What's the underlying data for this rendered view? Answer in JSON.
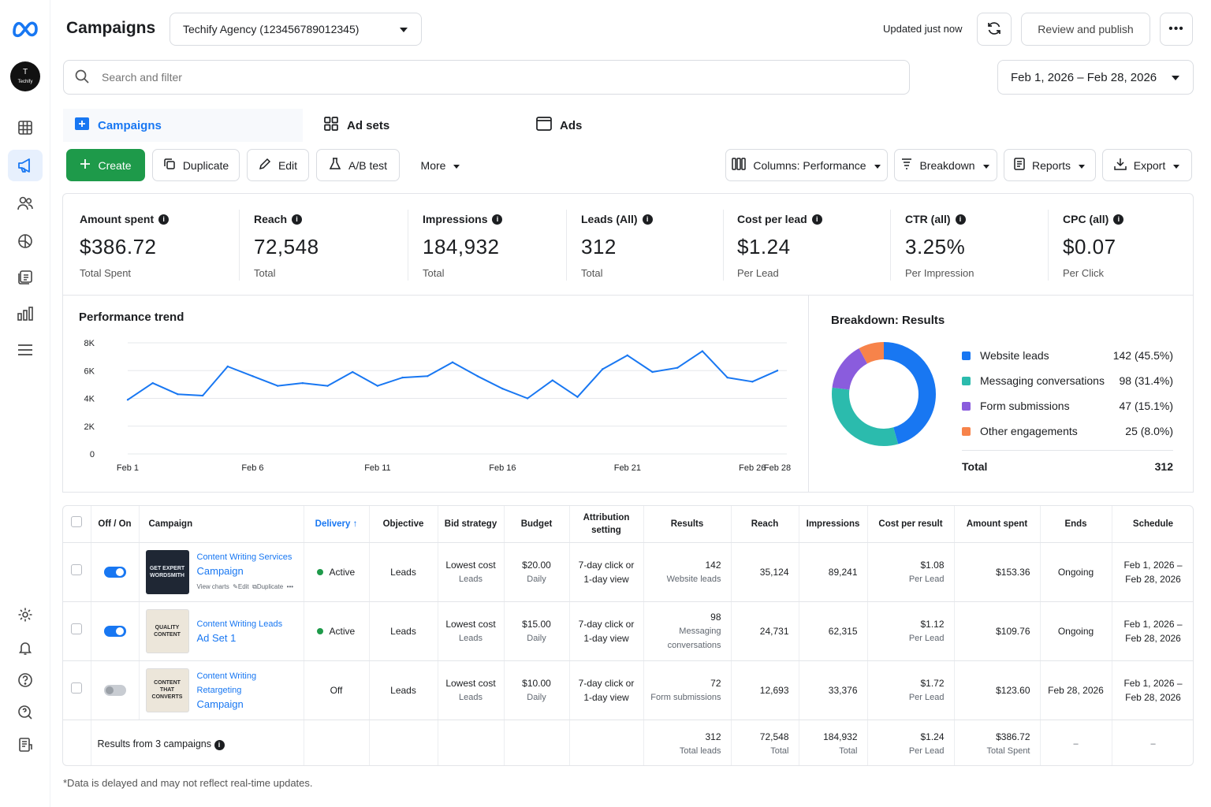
{
  "header": {
    "title": "Campaigns",
    "account": "Techify Agency (123456789012345)",
    "updated": "Updated just now",
    "publish_label": "Review and publish"
  },
  "avatar": {
    "initial": "T",
    "name": "Techify"
  },
  "search": {
    "placeholder": "Search and filter"
  },
  "date_range": "Feb 1, 2026 – Feb 28, 2026",
  "tabs": [
    {
      "label": "Campaigns",
      "active": true
    },
    {
      "label": "Ad sets",
      "active": false
    },
    {
      "label": "Ads",
      "active": false
    }
  ],
  "toolbar": {
    "create": "Create",
    "duplicate": "Duplicate",
    "edit": "Edit",
    "ab_test": "A/B test",
    "more": "More",
    "columns": "Columns: Performance",
    "breakdown": "Breakdown",
    "reports": "Reports",
    "export": "Export"
  },
  "kpis": [
    {
      "label": "Amount spent",
      "value": "$386.72",
      "sub": "Total Spent"
    },
    {
      "label": "Reach",
      "value": "72,548",
      "sub": "Total"
    },
    {
      "label": "Impressions",
      "value": "184,932",
      "sub": "Total"
    },
    {
      "label": "Leads (All)",
      "value": "312",
      "sub": "Total"
    },
    {
      "label": "Cost per lead",
      "value": "$1.24",
      "sub": "Per Lead"
    },
    {
      "label": "CTR (all)",
      "value": "3.25%",
      "sub": "Per Impression"
    },
    {
      "label": "CPC (all)",
      "value": "$0.07",
      "sub": "Per Click"
    }
  ],
  "chart_data": [
    {
      "type": "line",
      "title": "Performance trend",
      "x": [
        "Feb 1",
        "Feb 2",
        "Feb 3",
        "Feb 4",
        "Feb 5",
        "Feb 6",
        "Feb 7",
        "Feb 8",
        "Feb 9",
        "Feb 10",
        "Feb 11",
        "Feb 12",
        "Feb 13",
        "Feb 14",
        "Feb 15",
        "Feb 16",
        "Feb 17",
        "Feb 18",
        "Feb 19",
        "Feb 20",
        "Feb 21",
        "Feb 22",
        "Feb 23",
        "Feb 24",
        "Feb 25",
        "Feb 26",
        "Feb 27",
        "Feb 28"
      ],
      "x_tick_labels": [
        "Feb 1",
        "Feb 6",
        "Feb 11",
        "Feb 16",
        "Feb 21",
        "Feb 26",
        "Feb 28"
      ],
      "y_tick_labels": [
        "0",
        "2K",
        "4K",
        "6K",
        "8K"
      ],
      "ylim": [
        0,
        8000
      ],
      "grid": true,
      "series": [
        {
          "values": [
            3900,
            5100,
            4300,
            4200,
            6300,
            5600,
            4900,
            5100,
            4900,
            5900,
            4900,
            5500,
            5600,
            6600,
            5600,
            4700,
            4000,
            5300,
            4100,
            6100,
            7100,
            5900,
            6200,
            7400,
            5500,
            5200,
            6000
          ]
        }
      ],
      "color": "#1877f2"
    },
    {
      "type": "pie",
      "title": "Breakdown: Results",
      "categories": [
        "Website leads",
        "Messaging conversations",
        "Form submissions",
        "Other engagements"
      ],
      "values": [
        142,
        98,
        47,
        25
      ],
      "labels": [
        "142 (45.5%)",
        "98 (31.4%)",
        "47 (15.1%)",
        "25 (8.0%)"
      ],
      "colors": [
        "#1877f2",
        "#2bbbad",
        "#8a5cdd",
        "#f7834a"
      ],
      "total_label": "Total",
      "total": "312"
    }
  ],
  "table": {
    "headers": [
      "Off / On",
      "Campaign",
      "Delivery",
      "Objective",
      "Bid strategy",
      "Budget",
      "Attribution setting",
      "Results",
      "Reach",
      "Impressions",
      "Cost per result",
      "Amount spent",
      "Ends",
      "Schedule"
    ],
    "rows": [
      {
        "thumb": "GET EXPERT WORDSMITH",
        "line1": "Content Writing Services",
        "line2": "Campaign",
        "actions": [
          "View charts",
          "Edit",
          "Duplicate"
        ],
        "on": true,
        "delivery": "Active",
        "objective": "Leads",
        "bid1": "Lowest cost",
        "bid2": "Leads",
        "budget1": "$20.00",
        "budget2": "Daily",
        "attr1": "7-day click or",
        "attr2": "1-day view",
        "results1": "142",
        "results2": "Website leads",
        "reach": "35,124",
        "impressions": "89,241",
        "cpr1": "$1.08",
        "cpr2": "Per Lead",
        "spent": "$153.36",
        "ends": "Ongoing",
        "sched1": "Feb 1, 2026 –",
        "sched2": "Feb 28, 2026"
      },
      {
        "thumb": "QUALITY CONTENT",
        "line1": "Content Writing Leads",
        "line2": "Ad Set 1",
        "actions": [],
        "on": true,
        "delivery": "Active",
        "objective": "Leads",
        "bid1": "Lowest cost",
        "bid2": "Leads",
        "budget1": "$15.00",
        "budget2": "Daily",
        "attr1": "7-day click or",
        "attr2": "1-day view",
        "results1": "98",
        "results2": "Messaging conversations",
        "reach": "24,731",
        "impressions": "62,315",
        "cpr1": "$1.12",
        "cpr2": "Per Lead",
        "spent": "$109.76",
        "ends": "Ongoing",
        "sched1": "Feb 1, 2026 –",
        "sched2": "Feb 28, 2026"
      },
      {
        "thumb": "CONTENT THAT CONVERTS",
        "line1": "Content Writing Retargeting",
        "line2": "Campaign",
        "actions": [],
        "on": false,
        "delivery": "Off",
        "objective": "Leads",
        "bid1": "Lowest cost",
        "bid2": "Leads",
        "budget1": "$10.00",
        "budget2": "Daily",
        "attr1": "7-day click or",
        "attr2": "1-day view",
        "results1": "72",
        "results2": "Form submissions",
        "reach": "12,693",
        "impressions": "33,376",
        "cpr1": "$1.72",
        "cpr2": "Per Lead",
        "spent": "$123.60",
        "ends": "Feb 28, 2026",
        "sched1": "Feb 1, 2026 –",
        "sched2": "Feb 28, 2026"
      }
    ],
    "totals": {
      "label": "Results from 3 campaigns",
      "results1": "312",
      "results2": "Total leads",
      "reach1": "72,548",
      "reach2": "Total",
      "impr1": "184,932",
      "impr2": "Total",
      "cpr1": "$1.24",
      "cpr2": "Per Lead",
      "spent1": "$386.72",
      "spent2": "Total Spent",
      "ends": "–",
      "schedule": "–"
    }
  },
  "footnote": "*Data is delayed and may not reflect real-time updates.",
  "colors": {
    "accent": "#1877f2",
    "primary_button": "#1e9a4a"
  }
}
